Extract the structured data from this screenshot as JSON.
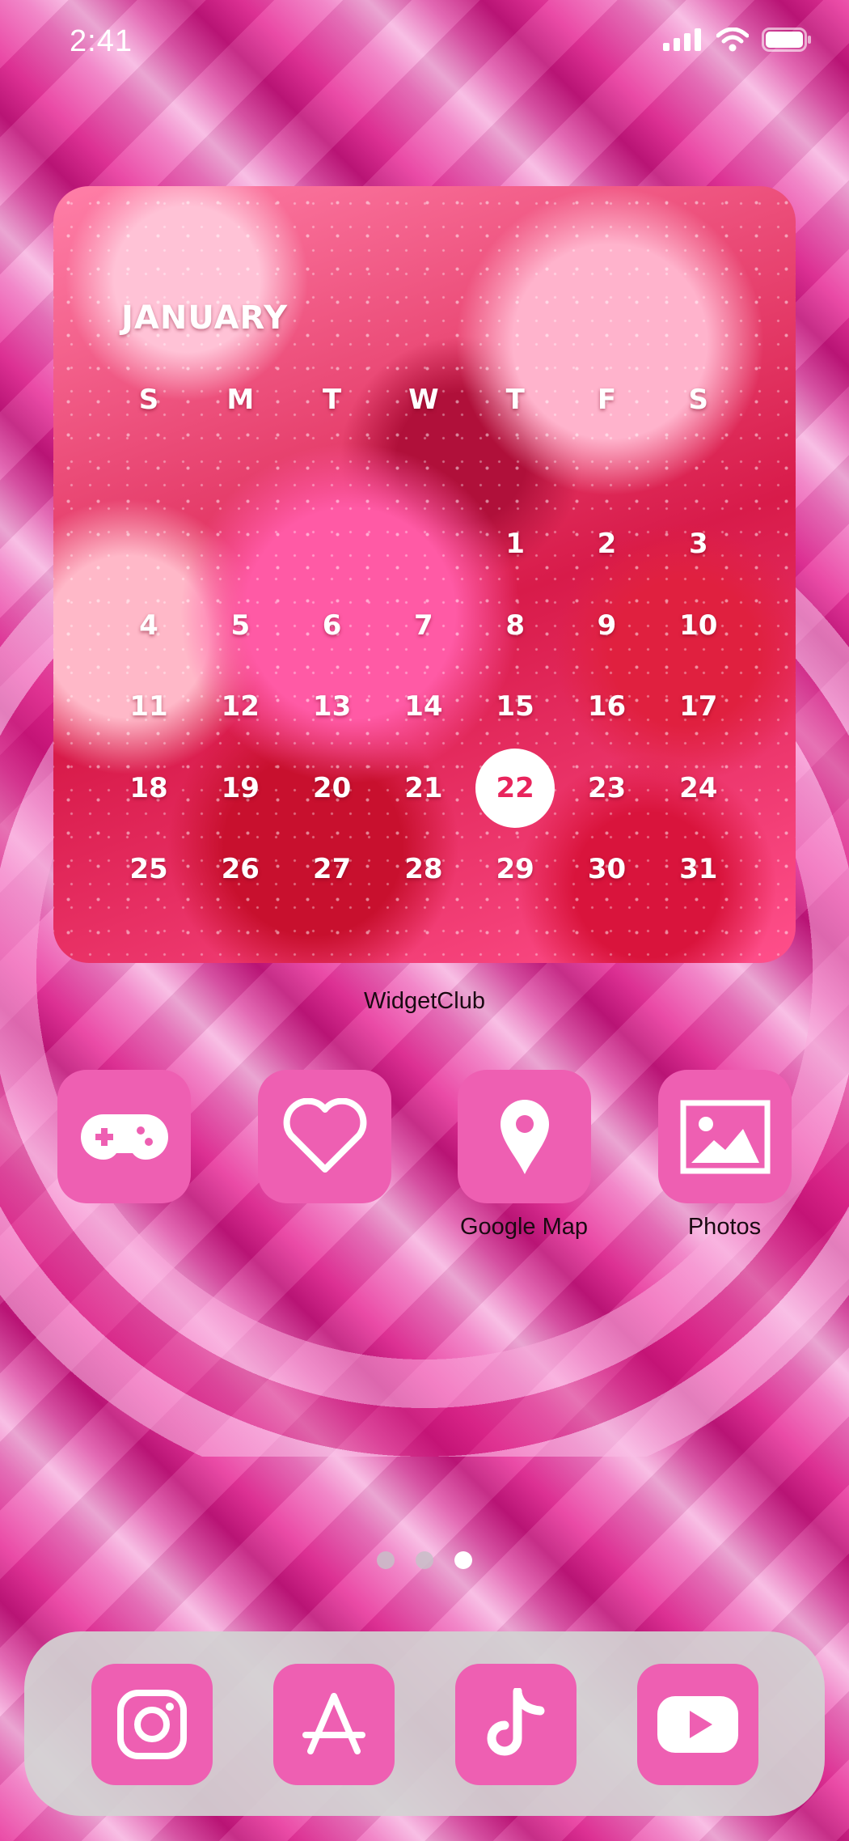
{
  "status_bar": {
    "time": "2:41"
  },
  "widget": {
    "month": "JANUARY",
    "weekdays": [
      "S",
      "M",
      "T",
      "W",
      "T",
      "F",
      "S"
    ],
    "weeks": [
      [
        "",
        "",
        "",
        "",
        "1",
        "2",
        "3"
      ],
      [
        "4",
        "5",
        "6",
        "7",
        "8",
        "9",
        "10"
      ],
      [
        "11",
        "12",
        "13",
        "14",
        "15",
        "16",
        "17"
      ],
      [
        "18",
        "19",
        "20",
        "21",
        "22",
        "23",
        "24"
      ],
      [
        "25",
        "26",
        "27",
        "28",
        "29",
        "30",
        "31"
      ]
    ],
    "today": "22",
    "label": "WidgetClub"
  },
  "apps": [
    {
      "name": "",
      "icon": "gamepad-icon"
    },
    {
      "name": "",
      "icon": "heart-icon"
    },
    {
      "name": "Google Map",
      "icon": "map-pin-icon"
    },
    {
      "name": "Photos",
      "icon": "photo-icon"
    }
  ],
  "pages": {
    "count": 3,
    "active": 3
  },
  "dock": [
    {
      "icon": "instagram-icon"
    },
    {
      "icon": "app-store-icon"
    },
    {
      "icon": "tiktok-icon"
    },
    {
      "icon": "youtube-icon"
    }
  ],
  "colors": {
    "icon_bg": "#ee5fb2",
    "today_text": "#e8245c",
    "dock_bg": "#d2d2d2"
  }
}
